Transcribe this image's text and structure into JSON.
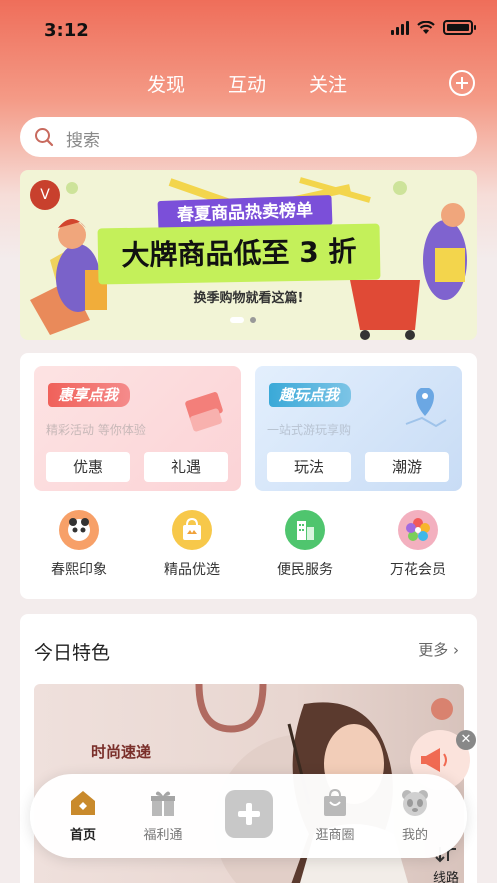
{
  "status_bar": {
    "time": "3:12"
  },
  "top_nav": {
    "tabs": [
      {
        "label": "发现"
      },
      {
        "label": "互动"
      },
      {
        "label": "关注"
      }
    ],
    "plus_icon": "plus-circle-icon"
  },
  "search": {
    "placeholder": "搜索"
  },
  "banner": {
    "sub_title": "春夏商品热卖榜单",
    "main_title": "大牌商品低至 3 折",
    "caption": "换季购物就看这篇!",
    "page_count": 2,
    "active_page": 1
  },
  "promos": [
    {
      "title": "惠享点我",
      "desc": "精彩活动 等你体验",
      "buttons": [
        "优惠",
        "礼遇"
      ]
    },
    {
      "title": "趣玩点我",
      "desc": "一站式游玩享购",
      "buttons": [
        "玩法",
        "潮游"
      ]
    }
  ],
  "quick_links": [
    {
      "label": "春熙印象",
      "icon": "panda-icon"
    },
    {
      "label": "精品优选",
      "icon": "shopping-bag-icon"
    },
    {
      "label": "便民服务",
      "icon": "building-icon"
    },
    {
      "label": "万花会员",
      "icon": "flower-icon"
    }
  ],
  "today": {
    "title": "今日特色",
    "more": "更多",
    "feature_text": "时尚速递"
  },
  "route": {
    "label": "线路"
  },
  "tabbar": {
    "items": [
      {
        "label": "首页",
        "icon": "home-icon",
        "active": true
      },
      {
        "label": "福利通",
        "icon": "gift-icon",
        "active": false
      },
      {
        "label": "",
        "icon": "plus-center-icon",
        "active": false
      },
      {
        "label": "逛商圈",
        "icon": "bag-icon",
        "active": false
      },
      {
        "label": "我的",
        "icon": "panda-face-icon",
        "active": false
      }
    ]
  },
  "colors": {
    "header_gradient_top": "#ef6e5a",
    "accent_red": "#f0615a",
    "accent_blue": "#3aa9d8",
    "banner_purple": "#7b4fd9",
    "banner_lime": "#c4f05a"
  }
}
